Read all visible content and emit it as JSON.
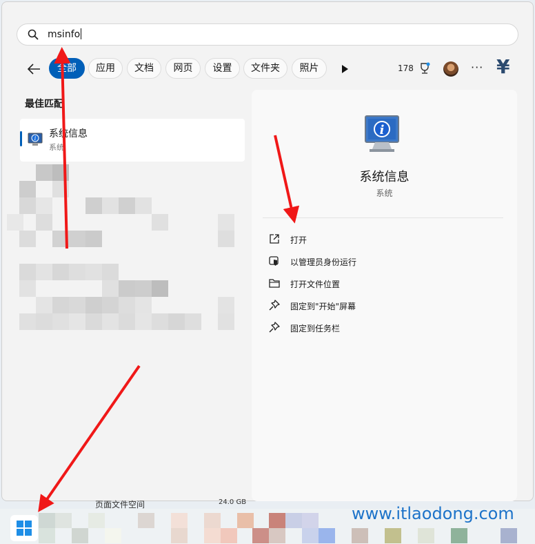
{
  "search": {
    "value": "msinfo"
  },
  "tabs": [
    "全部",
    "应用",
    "文档",
    "网页",
    "设置",
    "文件夹",
    "照片"
  ],
  "header": {
    "count": "178",
    "more": "···",
    "logo": "¥"
  },
  "best_match": {
    "title": "最佳匹配",
    "name": "系统信息",
    "type": "系统"
  },
  "detail": {
    "name": "系统信息",
    "type": "系统",
    "actions": [
      {
        "label": "打开",
        "icon": "open-external-icon"
      },
      {
        "label": "以管理员身份运行",
        "icon": "shield-icon"
      },
      {
        "label": "打开文件位置",
        "icon": "folder-icon"
      },
      {
        "label": "固定到\"开始\"屏幕",
        "icon": "pin-icon"
      },
      {
        "label": "固定到任务栏",
        "icon": "pin-icon"
      }
    ]
  },
  "background": {
    "text": "页面文件空间",
    "size": "24.0 GB"
  },
  "watermark": "www.itlaodong.com",
  "colors": {
    "accent": "#005fb8",
    "annotation_arrow": "#f01818"
  },
  "icons": [
    "search-icon",
    "back-arrow-icon",
    "play-icon",
    "trophy-icon",
    "avatar",
    "more-icon",
    "system-info-icon",
    "windows-start-icon"
  ]
}
